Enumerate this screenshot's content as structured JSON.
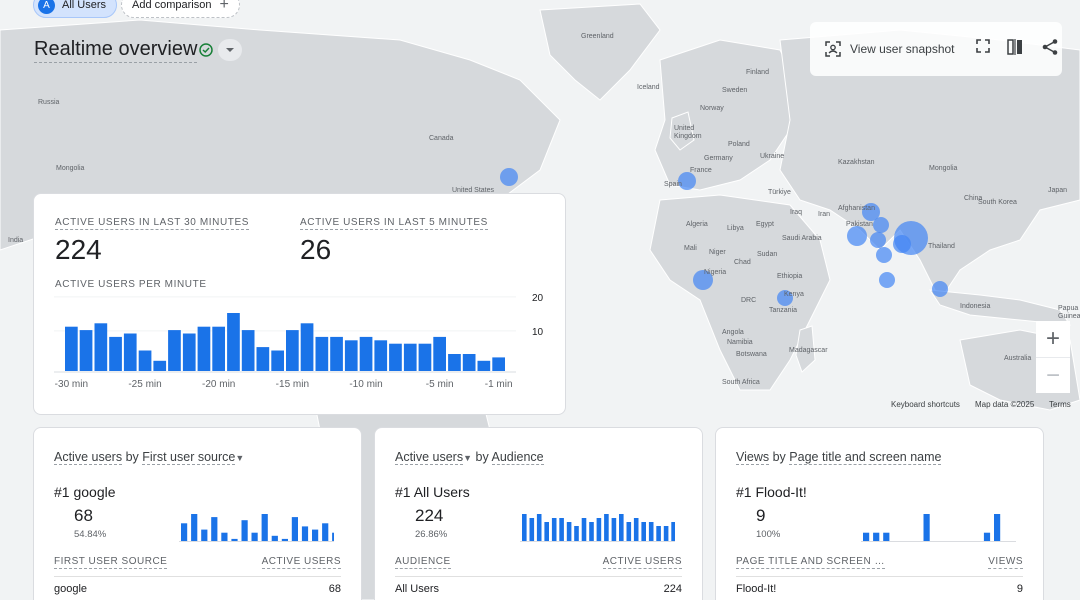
{
  "header": {
    "segment_chip": {
      "initial": "A",
      "label": "All Users"
    },
    "add_comparison": "Add comparison",
    "title": "Realtime overview",
    "snapshot_label": "View user snapshot"
  },
  "map": {
    "labels": {
      "greenland": "Greenland",
      "finland": "Finland",
      "iceland": "Iceland",
      "sweden": "Sweden",
      "norway": "Norway",
      "united_kingdom": "United\nKingdom",
      "russia_left": "Russia",
      "poland": "Poland",
      "germany": "Germany",
      "ukraine": "Ukraine",
      "kazakhstan": "Kazakhstan",
      "mongolia_left": "Mongolia",
      "canada": "Canada",
      "france": "France",
      "spain": "Spain",
      "turkiye": "Türkiye",
      "mongolia_right": "Mongolia",
      "china": "China",
      "south_korea": "South Korea",
      "japan": "Japan",
      "united_states": "United States",
      "afghanistan": "Afghanistan",
      "iran": "Iran",
      "iraq": "Iraq",
      "pakistan": "Pakistan",
      "algeria": "Algeria",
      "libya": "Libya",
      "egypt": "Egypt",
      "saudi_arabia": "Saudi Arabia",
      "india_left": "India",
      "thailand": "Thailand",
      "mali": "Mali",
      "niger": "Niger",
      "chad": "Chad",
      "sudan": "Sudan",
      "nigeria": "Nigeria",
      "ethiopia": "Ethiopia",
      "kenya": "Kenya",
      "drc": "DRC",
      "tanzania": "Tanzania",
      "angola": "Angola",
      "namibia": "Namibia",
      "botswana": "Botswana",
      "madagascar": "Madagascar",
      "south_africa": "South Africa",
      "indonesia": "Indonesia",
      "papua_new_guinea": "Papua New\nGuinea",
      "australia": "Australia"
    },
    "attribution": {
      "shortcuts": "Keyboard shortcuts",
      "data": "Map data ©2025",
      "terms": "Terms"
    },
    "zoom_in": "+",
    "zoom_out": "−"
  },
  "realtime_card": {
    "label_30": "ACTIVE USERS IN LAST 30 MINUTES",
    "value_30": "224",
    "label_5": "ACTIVE USERS IN LAST 5 MINUTES",
    "value_5": "26",
    "per_minute_label": "ACTIVE USERS PER MINUTE"
  },
  "chart_data": {
    "type": "bar",
    "categories": [
      "-30 min",
      "-29",
      "-28",
      "-27",
      "-26",
      "-25 min",
      "-24",
      "-23",
      "-22",
      "-21",
      "-20 min",
      "-19",
      "-18",
      "-17",
      "-16",
      "-15 min",
      "-14",
      "-13",
      "-12",
      "-11",
      "-10 min",
      "-9",
      "-8",
      "-7",
      "-6",
      "-5 min",
      "-4",
      "-3",
      "-2",
      "-1 min"
    ],
    "values": [
      13,
      12,
      14,
      10,
      11,
      6,
      3,
      12,
      11,
      13,
      13,
      17,
      12,
      7,
      6,
      12,
      14,
      10,
      10,
      9,
      10,
      9,
      8,
      8,
      8,
      10,
      5,
      5,
      3,
      4
    ],
    "tick_labels": [
      "-30 min",
      "-25 min",
      "-20 min",
      "-15 min",
      "-10 min",
      "-5 min",
      "-1 min"
    ],
    "y_ticks": [
      "20",
      "10"
    ],
    "ylim": [
      0,
      22
    ],
    "color": "#1a73e8"
  },
  "bottom_cards": [
    {
      "title_metric": "Active users",
      "title_by": "by",
      "title_dim": "First user source",
      "rank": "#1",
      "top_name": "google",
      "top_value": "68",
      "top_pct": "54.84%",
      "col1": "FIRST USER SOURCE",
      "col2": "ACTIVE USERS",
      "row_name": "google",
      "row_value": "68",
      "spark": [
        6,
        9,
        4,
        8,
        3,
        1,
        7,
        3,
        9,
        2,
        1,
        8,
        5,
        4,
        6,
        3,
        5,
        2,
        4,
        1
      ]
    },
    {
      "title_metric": "Active users",
      "title_by": "by",
      "title_dim": "Audience",
      "rank": "#1",
      "top_name": "All Users",
      "top_value": "224",
      "top_pct": "26.86%",
      "col1": "AUDIENCE",
      "col2": "ACTIVE USERS",
      "row_name": "All Users",
      "row_value": "224",
      "spark": [
        7,
        6,
        7,
        5,
        6,
        6,
        5,
        4,
        6,
        5,
        6,
        7,
        6,
        7,
        5,
        6,
        5,
        5,
        4,
        4,
        5,
        4,
        4,
        3,
        3,
        2,
        3
      ]
    },
    {
      "title_metric": "Views",
      "title_by": "by",
      "title_dim": "Page title and screen name",
      "rank": "#1",
      "top_name": "Flood-It!",
      "top_value": "9",
      "top_pct": "100%",
      "col1": "PAGE TITLE AND SCREEN …",
      "col2": "VIEWS",
      "row_name": "Flood-It!",
      "row_value": "9",
      "spark": [
        1,
        1,
        1,
        0,
        0,
        0,
        3,
        0,
        0,
        0,
        0,
        0,
        1,
        3
      ]
    }
  ],
  "colors": {
    "accent": "#1a73e8",
    "map_land": "#d6d9dc",
    "map_water": "#f1f3f4"
  }
}
